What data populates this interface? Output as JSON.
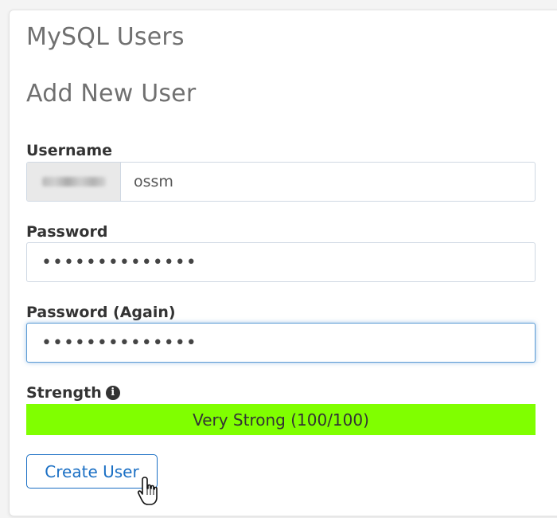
{
  "header": {
    "title": "MySQL Users",
    "subtitle": "Add New User"
  },
  "form": {
    "username": {
      "label": "Username",
      "value": "ossm"
    },
    "password": {
      "label": "Password",
      "value": "••••••••••••••"
    },
    "password_again": {
      "label": "Password (Again)",
      "value": "••••••••••••••"
    },
    "strength": {
      "label": "Strength",
      "info_icon": "info-icon",
      "text": "Very Strong (100/100)",
      "score_percent": 100,
      "bar_color": "#80ff00"
    },
    "submit_label": "Create User"
  },
  "colors": {
    "accent": "#1a6fc4",
    "focus": "#5b9bd5"
  },
  "icons": {
    "cursor": "hand-pointer-icon"
  }
}
